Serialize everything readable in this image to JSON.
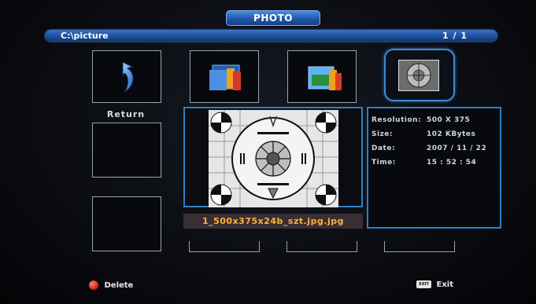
{
  "header": {
    "title": "PHOTO"
  },
  "path_bar": {
    "path": "C:\\picture",
    "page": "1 / 1"
  },
  "grid": {
    "return_label": "Return",
    "tiles": [
      {
        "icon": "return-arrow-icon"
      },
      {
        "icon": "folder-icon"
      },
      {
        "icon": "folder-icon"
      },
      {
        "icon": "image-file-icon"
      }
    ]
  },
  "preview": {
    "filename": "1_500x375x24b_szt.jpg.jpg"
  },
  "info": {
    "rows": [
      {
        "key": "Resolution:",
        "value": "500 X 375"
      },
      {
        "key": "Size:",
        "value": "102 KBytes"
      },
      {
        "key": "Date:",
        "value": "2007 / 11 / 22"
      },
      {
        "key": "Time:",
        "value": "15 : 52 : 54"
      }
    ]
  },
  "footer": {
    "delete_label": "Delete",
    "exit_key": "EXIT",
    "exit_label": "Exit"
  },
  "colors": {
    "accent": "#2f7fc4",
    "filename_text": "#ffb23a",
    "delete_dot": "#d21c12"
  }
}
